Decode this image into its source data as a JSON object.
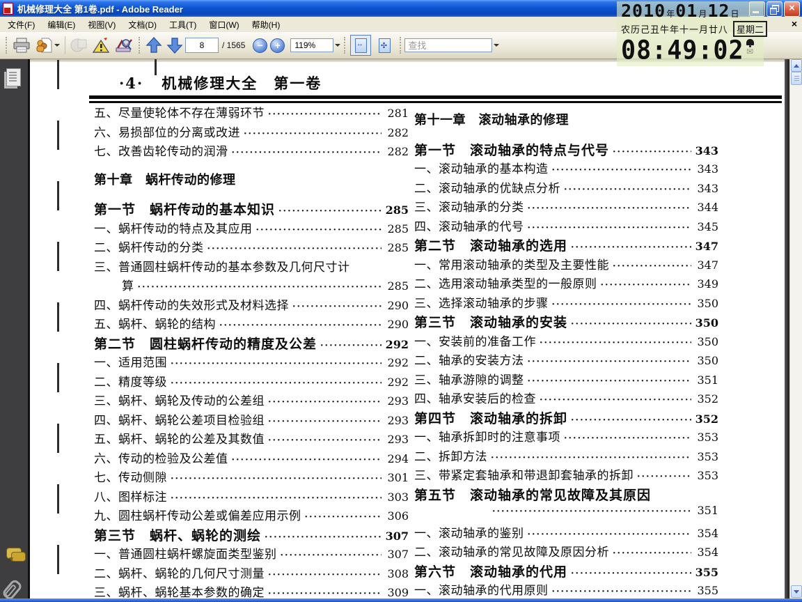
{
  "window": {
    "title": "机械修理大全 第1卷.pdf - Adobe Reader"
  },
  "menu": {
    "items": [
      "文件(F)",
      "编辑(E)",
      "视图(V)",
      "文档(D)",
      "工具(T)",
      "窗口(W)",
      "帮助(H)"
    ]
  },
  "toolbar": {
    "page_current": "8",
    "page_total_label": "/ 1565",
    "zoom_level": "119%",
    "find_placeholder": "查找"
  },
  "clock": {
    "date": {
      "year": "2010",
      "year_unit": "年",
      "month": "01",
      "month_unit": "月",
      "day": "12",
      "day_unit": "日"
    },
    "lunar_label": "农历己丑牛年十一月廿八",
    "weekday": "星期二",
    "time": "08:49:02"
  },
  "document": {
    "header": {
      "page_marker": "·4·",
      "title": "机械修理大全　第一卷"
    },
    "left_column": [
      {
        "type": "item",
        "text": "五、尽量使轮体不存在薄弱环节",
        "page": "281"
      },
      {
        "type": "item",
        "text": "六、易损部位的分离或改进",
        "page": "282"
      },
      {
        "type": "item",
        "text": "七、改善齿轮传动的润滑",
        "page": "282"
      },
      {
        "type": "chapter",
        "text": "第十章　蜗杆传动的修理"
      },
      {
        "type": "section",
        "text": "第一节　蜗杆传动的基本知识",
        "page": "285"
      },
      {
        "type": "item",
        "text": "一、蜗杆传动的特点及其应用",
        "page": "285"
      },
      {
        "type": "item",
        "text": "二、蜗杆传动的分类",
        "page": "285"
      },
      {
        "type": "wrap",
        "text": "三、普通圆柱蜗杆传动的基本参数及几何尺寸计"
      },
      {
        "type": "cont",
        "text": "算",
        "page": "285"
      },
      {
        "type": "item",
        "text": "四、蜗杆传动的失效形式及材料选择",
        "page": "290"
      },
      {
        "type": "item",
        "text": "五、蜗杆、蜗轮的结构",
        "page": "290"
      },
      {
        "type": "section",
        "text": "第二节　圆柱蜗杆传动的精度及公差",
        "page": "292"
      },
      {
        "type": "item",
        "text": "一、适用范围",
        "page": "292"
      },
      {
        "type": "item",
        "text": "二、精度等级",
        "page": "292"
      },
      {
        "type": "item",
        "text": "三、蜗杆、蜗轮及传动的公差组",
        "page": "293"
      },
      {
        "type": "item",
        "text": "四、蜗杆、蜗轮公差项目检验组",
        "page": "293"
      },
      {
        "type": "item",
        "text": "五、蜗杆、蜗轮的公差及其数值",
        "page": "293"
      },
      {
        "type": "item",
        "text": "六、传动的检验及公差值",
        "page": "294"
      },
      {
        "type": "item",
        "text": "七、传动侧隙",
        "page": "301"
      },
      {
        "type": "item",
        "text": "八、图样标注",
        "page": "303"
      },
      {
        "type": "item",
        "text": "九、圆柱蜗杆传动公差或偏差应用示例",
        "page": "306"
      },
      {
        "type": "section",
        "text": "第三节　蜗杆、蜗轮的测绘",
        "page": "307"
      },
      {
        "type": "item",
        "text": "一、普通圆柱蜗杆螺旋面类型鉴别",
        "page": "307"
      },
      {
        "type": "item",
        "text": "二、蜗杆、蜗轮的几何尺寸测量",
        "page": "308"
      },
      {
        "type": "item",
        "text": "三、蜗杆、蜗轮基本参数的确定",
        "page": "309"
      }
    ],
    "right_column": [
      {
        "type": "chapter",
        "text": "第十一章　滚动轴承的修理"
      },
      {
        "type": "section",
        "text": "第一节　滚动轴承的特点与代号",
        "page": "343"
      },
      {
        "type": "item",
        "text": "一、滚动轴承的基本构造",
        "page": "343"
      },
      {
        "type": "item",
        "text": "二、滚动轴承的优缺点分析",
        "page": "343"
      },
      {
        "type": "item",
        "text": "三、滚动轴承的分类",
        "page": "344"
      },
      {
        "type": "item",
        "text": "四、滚动轴承的代号",
        "page": "345"
      },
      {
        "type": "section",
        "text": "第二节　滚动轴承的选用",
        "page": "347"
      },
      {
        "type": "item",
        "text": "一、常用滚动轴承的类型及主要性能",
        "page": "347"
      },
      {
        "type": "item",
        "text": "二、选用滚动轴承类型的一般原则",
        "page": "349"
      },
      {
        "type": "item",
        "text": "三、选择滚动轴承的步骤",
        "page": "350"
      },
      {
        "type": "section",
        "text": "第三节　滚动轴承的安装",
        "page": "350"
      },
      {
        "type": "item",
        "text": "一、安装前的准备工作",
        "page": "350"
      },
      {
        "type": "item",
        "text": "二、轴承的安装方法",
        "page": "350"
      },
      {
        "type": "item",
        "text": "三、轴承游隙的调整",
        "page": "351"
      },
      {
        "type": "item",
        "text": "四、轴承安装后的检查",
        "page": "352"
      },
      {
        "type": "section",
        "text": "第四节　滚动轴承的拆卸",
        "page": "352"
      },
      {
        "type": "item",
        "text": "一、轴承拆卸时的注意事项",
        "page": "353"
      },
      {
        "type": "item",
        "text": "二、拆卸方法",
        "page": "353"
      },
      {
        "type": "item",
        "text": "三、带紧定套轴承和带退卸套轴承的拆卸",
        "page": "353"
      },
      {
        "type": "secwrap",
        "text": "第五节　滚动轴承的常见故障及其原因"
      },
      {
        "type": "cont2",
        "text": "",
        "page": "351"
      },
      {
        "type": "item",
        "text": "一、滚动轴承的鉴别",
        "page": "354"
      },
      {
        "type": "item",
        "text": "二、滚动轴承的常见故障及原因分析",
        "page": "354"
      },
      {
        "type": "section",
        "text": "第六节　滚动轴承的代用",
        "page": "355"
      },
      {
        "type": "item",
        "text": "一、滚动轴承的代用原则",
        "page": "355"
      }
    ]
  }
}
